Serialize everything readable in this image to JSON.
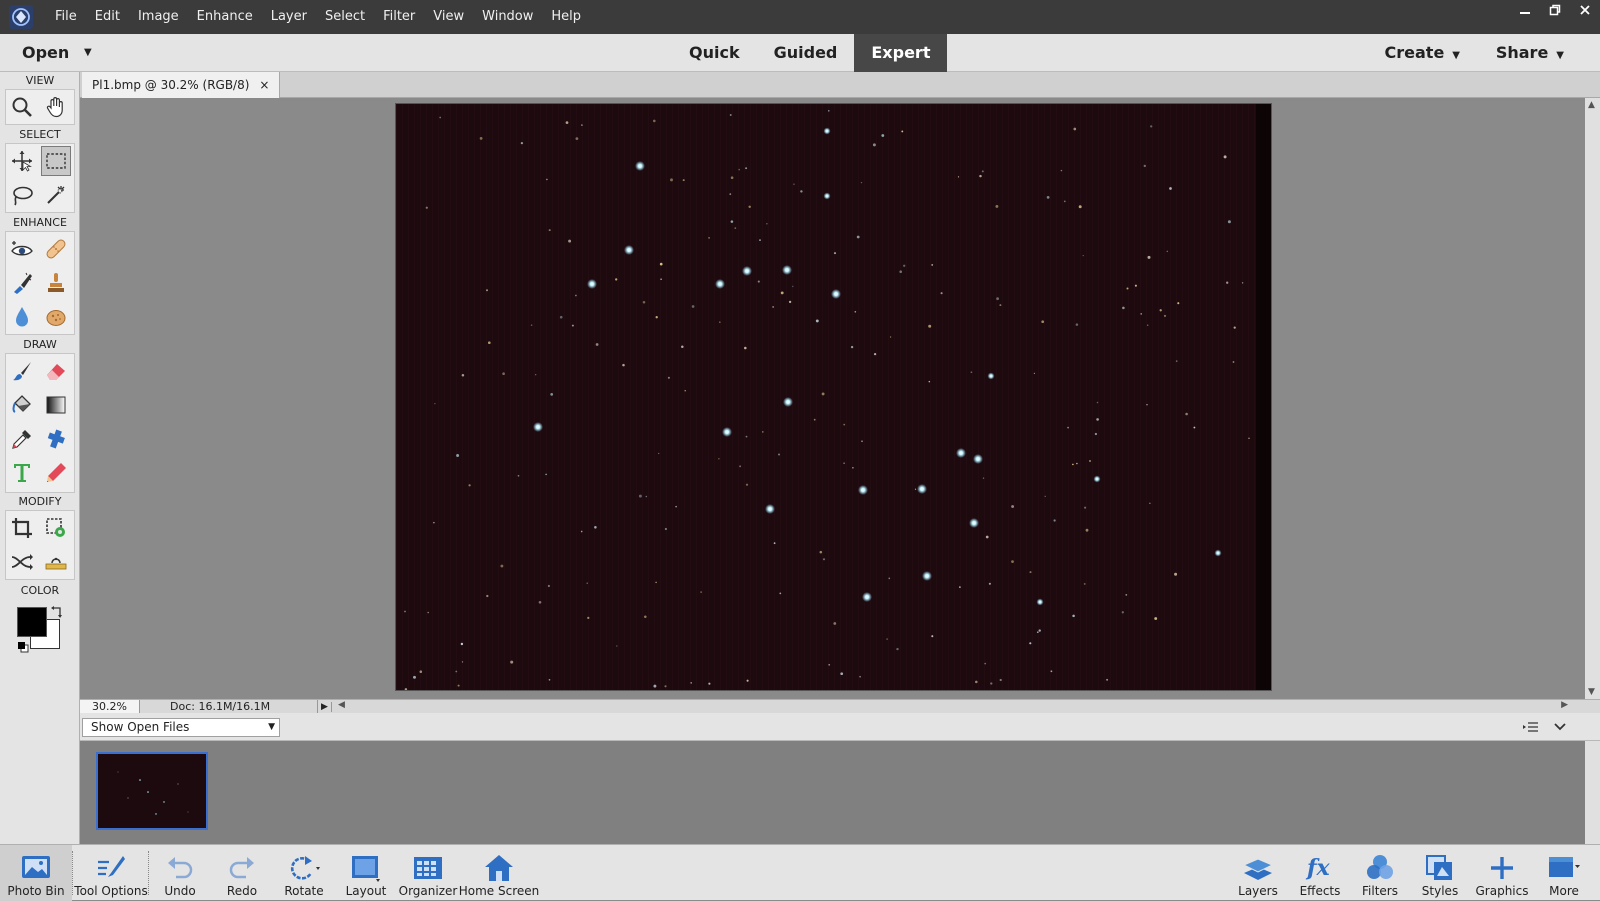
{
  "menu": {
    "items": [
      "File",
      "Edit",
      "Image",
      "Enhance",
      "Layer",
      "Select",
      "Filter",
      "View",
      "Window",
      "Help"
    ]
  },
  "modebar": {
    "open_label": "Open",
    "tabs": [
      "Quick",
      "Guided",
      "Expert"
    ],
    "active_tab": "Expert",
    "create_label": "Create",
    "share_label": "Share"
  },
  "toolbox": {
    "sections": {
      "view": "VIEW",
      "select": "SELECT",
      "enhance": "ENHANCE",
      "draw": "DRAW",
      "modify": "MODIFY",
      "color": "COLOR"
    },
    "foreground_color": "#000000",
    "background_color": "#ffffff"
  },
  "document": {
    "tab_title": "Pl1.bmp @ 30.2% (RGB/8)",
    "close_glyph": "×"
  },
  "status": {
    "zoom": "30.2%",
    "doc_size": "Doc: 16.1M/16.1M"
  },
  "photo_bin": {
    "filter_label": "Show Open Files"
  },
  "taskbar": {
    "photo_bin": "Photo Bin",
    "tool_options": "Tool Options",
    "undo": "Undo",
    "redo": "Redo",
    "rotate": "Rotate",
    "layout": "Layout",
    "organizer": "Organizer",
    "home_screen": "Home Screen",
    "layers": "Layers",
    "effects": "Effects",
    "filters": "Filters",
    "styles": "Styles",
    "graphics": "Graphics",
    "more": "More"
  },
  "colors": {
    "accent_blue": "#2e6fc4",
    "photo_bg": "#1d0a0e",
    "menubar_bg": "#3b3b3b",
    "active_tab_bg": "#474747"
  }
}
